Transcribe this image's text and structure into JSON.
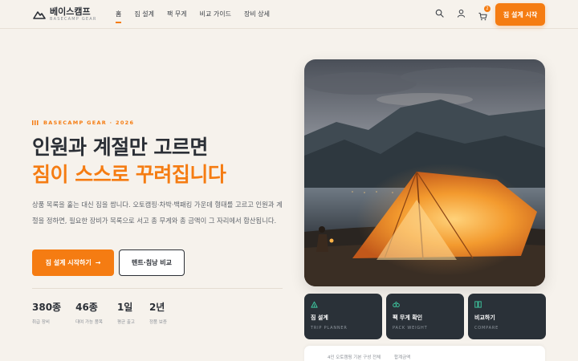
{
  "brand": {
    "name": "베이스캠프",
    "sub": "BASECAMP GEAR",
    "accent_color": "#f57c12",
    "dark_color": "#2b2f36"
  },
  "nav": {
    "items": [
      {
        "label": "홈",
        "active": true
      },
      {
        "label": "짐 설계",
        "active": false
      },
      {
        "label": "팩 무게",
        "active": false
      },
      {
        "label": "비교 가이드",
        "active": false
      },
      {
        "label": "장비 상세",
        "active": false
      }
    ]
  },
  "header_icons": {
    "search": "search-icon",
    "account": "user-icon",
    "cart": "cart-icon",
    "cart_count": "2"
  },
  "header_cta": "짐 설계 시작",
  "hero": {
    "eyebrow": "BASECAMP GEAR · 2026",
    "title_line1": "인원과 계절만 고르면",
    "title_line2": "짐이 스스로 꾸려집니다",
    "description": "상품 목록을 훑는 대신 짐을 쌉니다. 오토캠핑·차박·백패킹 가운데 형태를 고르고 인원과 계절을 정하면, 필요한 장비가 목록으로 서고 총 무게와 총 금액이 그 자리에서 합산됩니다.",
    "primary_button": "짐 설계 시작하기",
    "primary_arrow": "→",
    "secondary_button": "텐트·침낭 비교"
  },
  "stats": [
    {
      "value": "380종",
      "label": "취급 장비"
    },
    {
      "value": "46종",
      "label": "대여 가능 품목"
    },
    {
      "value": "1일",
      "label": "평균 출고"
    },
    {
      "value": "2년",
      "label": "정품 보증"
    }
  ],
  "feature_cards": [
    {
      "icon": "tent-icon",
      "title": "짐 설계",
      "sub": "TRIP PLANNER"
    },
    {
      "icon": "backpack-icon",
      "title": "팩 무게 확인",
      "sub": "PACK WEIGHT"
    },
    {
      "icon": "compare-icon",
      "title": "비교하기",
      "sub": "COMPARE"
    }
  ],
  "bottom_panel": {
    "left_text": "4인 오토캠핑 기본 구성 전체",
    "right_text": "합계금액"
  }
}
